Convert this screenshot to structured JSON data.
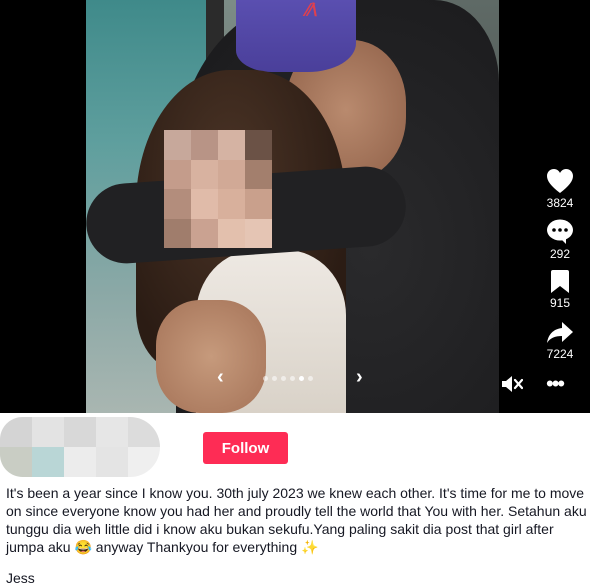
{
  "carousel": {
    "prev_glyph": "‹",
    "next_glyph": "›",
    "dot_count": 6,
    "active_dot": 4
  },
  "actions": [
    {
      "name": "like",
      "icon": "heart-icon",
      "count": "3824"
    },
    {
      "name": "comment",
      "icon": "comment-icon",
      "count": "292"
    },
    {
      "name": "save",
      "icon": "bookmark-icon",
      "count": "915"
    },
    {
      "name": "share",
      "icon": "share-icon",
      "count": "7224"
    }
  ],
  "controls": {
    "mute_icon": "speaker-muted-icon",
    "more_icon": "more-horizontal-icon",
    "more_glyph": "•••"
  },
  "author": {
    "follow_label": "Follow",
    "username": "Jess"
  },
  "post": {
    "caption": "It's been a year since I know you. 30th july 2023 we knew each other. It's time for me to move on since everyone know you had her and proudly tell the world that You with her. Setahun aku tunggu dia weh little did i know aku bukan sekufu.Yang paling sakit dia post that girl after jumpa aku 😂 anyway Thankyou for everything ✨"
  },
  "colors": {
    "accent": "#fe2c55",
    "media_background": "#000000",
    "text": "#161823"
  }
}
